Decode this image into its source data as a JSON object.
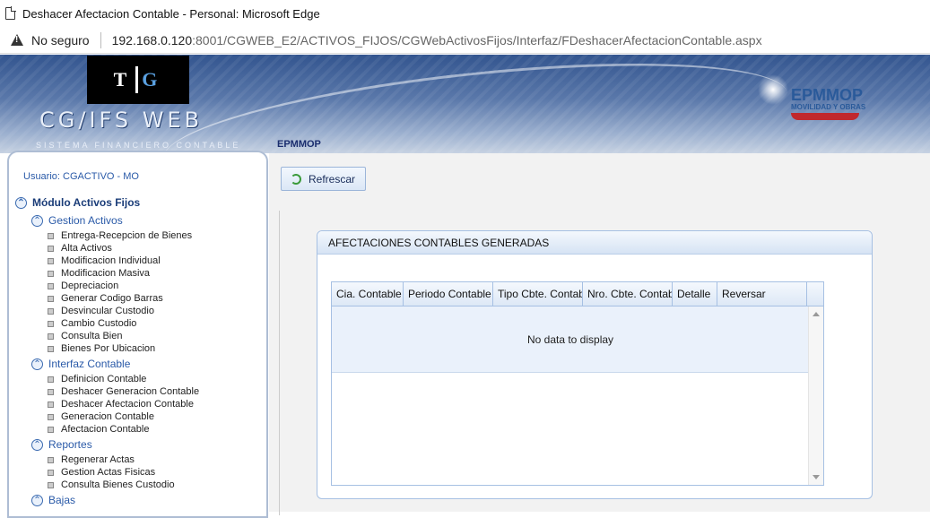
{
  "browser": {
    "window_title": "Deshacer Afectacion Contable - Personal: Microsoft Edge",
    "security_label": "No seguro",
    "url_host": "192.168.0.120",
    "url_path": ":8001/CGWEB_E2/ACTIVOS_FIJOS/CGWebActivosFijos/Interfaz/FDeshacerAfectacionContable.aspx"
  },
  "header": {
    "logo_text": "TIG",
    "brand": "CG/IFS WEB",
    "brand_sub": "SISTEMA FINANCIERO CONTABLE",
    "org_logo": "EPMMOP",
    "org_logo_sub": "MOVILIDAD Y OBRAS",
    "breadcrumb": "EPMMOP"
  },
  "sidebar": {
    "user": "Usuario: CGACTIVO - MO",
    "module": "Módulo Activos Fijos",
    "groups": [
      {
        "label": "Gestion Activos",
        "items": [
          "Entrega-Recepcion de Bienes",
          "Alta Activos",
          "Modificacion Individual",
          "Modificacion Masiva",
          "Depreciacion",
          "Generar Codigo Barras",
          "Desvincular Custodio",
          "Cambio Custodio",
          "Consulta Bien",
          "Bienes Por Ubicacion"
        ]
      },
      {
        "label": "Interfaz Contable",
        "items": [
          "Definicion Contable",
          "Deshacer Generacion Contable",
          "Deshacer Afectacion Contable",
          "Generacion Contable",
          "Afectacion Contable"
        ]
      },
      {
        "label": "Reportes",
        "items": [
          "Regenerar Actas",
          "Gestion Actas Fisicas",
          "Consulta Bienes Custodio"
        ]
      },
      {
        "label": "Bajas",
        "items": []
      }
    ]
  },
  "main": {
    "refresh_label": "Refrescar",
    "panel_title": "AFECTACIONES CONTABLES  GENERADAS",
    "columns": [
      "Cia. Contable",
      "Periodo Contable",
      "Tipo Cbte. Contable",
      "Nro. Cbte. Contable",
      "Detalle",
      "Reversar"
    ],
    "empty_text": "No data to display"
  }
}
